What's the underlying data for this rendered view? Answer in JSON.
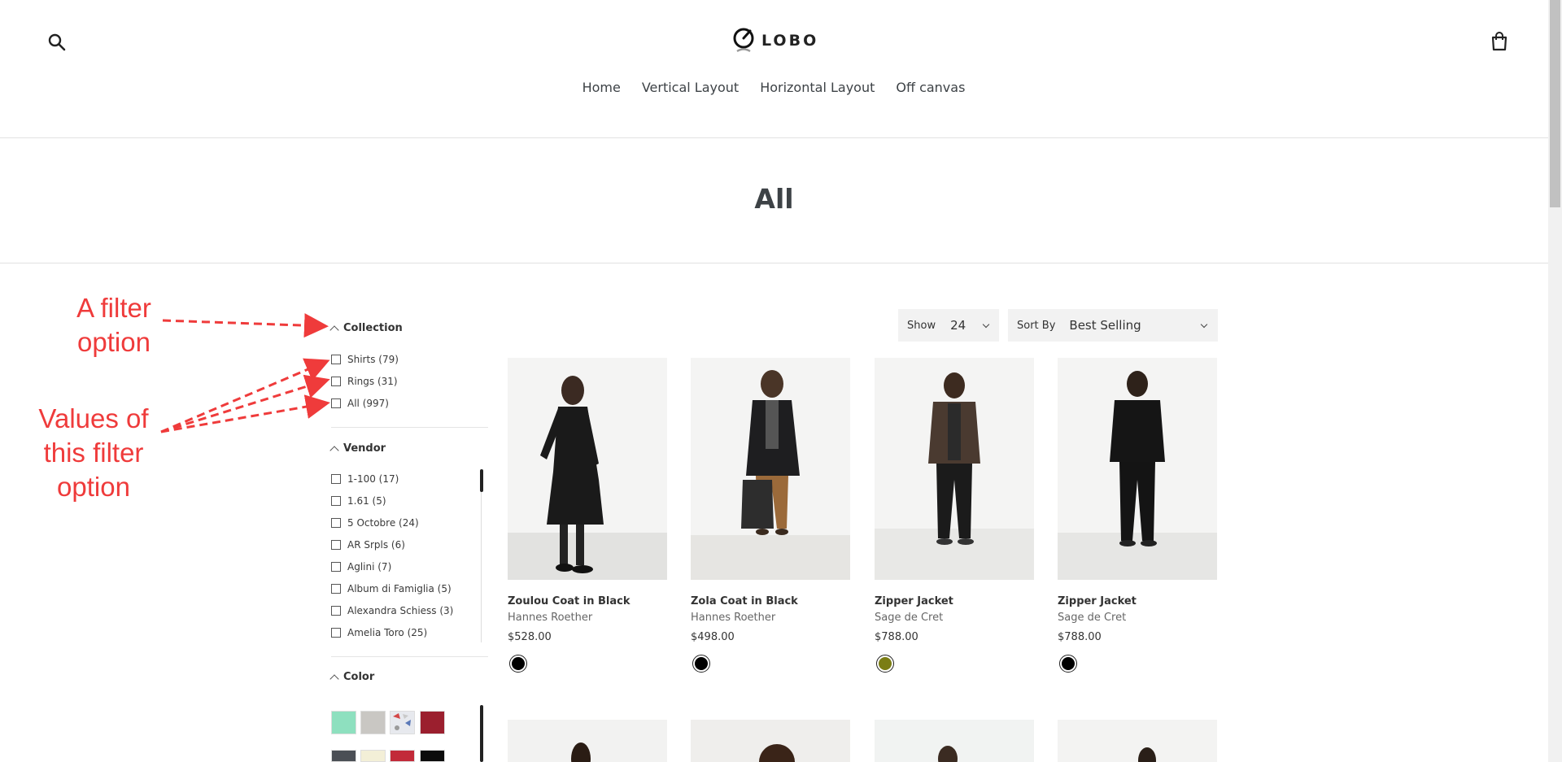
{
  "header": {
    "logo_text": "LOBO",
    "nav": [
      "Home",
      "Vertical Layout",
      "Horizontal Layout",
      "Off canvas"
    ]
  },
  "page": {
    "title": "All"
  },
  "filters": {
    "collection": {
      "title": "Collection",
      "options": [
        "Shirts (79)",
        "Rings (31)",
        "All (997)"
      ]
    },
    "vendor": {
      "title": "Vendor",
      "options": [
        "1-100 (17)",
        "1.61 (5)",
        "5 Octobre (24)",
        "AR Srpls (6)",
        "Aglini (7)",
        "Album di Famiglia (5)",
        "Alexandra Schiess (3)",
        "Amelia Toro (25)"
      ]
    },
    "color": {
      "title": "Color",
      "swatches": [
        "#8ee0bf",
        "#c9c7c3",
        "#e7e9ee",
        "#9b1f2e",
        "#4b4f55",
        "#f3efd7",
        "#c22a39",
        "#0b0b0b"
      ]
    }
  },
  "controls": {
    "show_label": "Show",
    "show_value": "24",
    "sort_label": "Sort By",
    "sort_value": "Best Selling"
  },
  "products": [
    {
      "title": "Zoulou Coat in Black",
      "vendor": "Hannes Roether",
      "price": "$528.00",
      "color": "#000000"
    },
    {
      "title": "Zola Coat in Black",
      "vendor": "Hannes Roether",
      "price": "$498.00",
      "color": "#000000"
    },
    {
      "title": "Zipper Jacket",
      "vendor": "Sage de Cret",
      "price": "$788.00",
      "color": "#7b7d14"
    },
    {
      "title": "Zipper Jacket",
      "vendor": "Sage de Cret",
      "price": "$788.00",
      "color": "#000000"
    }
  ],
  "annotations": {
    "filter_option": "A filter\noption",
    "filter_values": "Values of\nthis filter\noption"
  },
  "icons": [
    "search-icon",
    "cart-icon",
    "logo-icon",
    "chevron-up-icon",
    "chevron-down-icon"
  ]
}
